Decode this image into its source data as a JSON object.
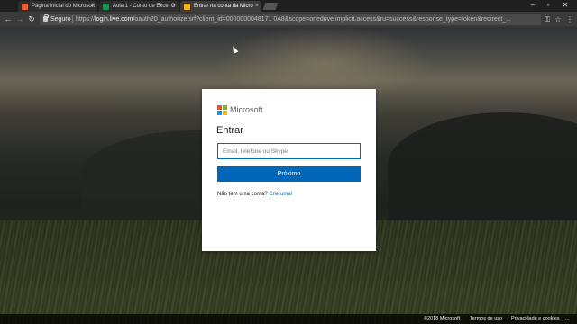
{
  "browser": {
    "tabs": [
      {
        "title": "Página Inicial do Microsoft",
        "favicon_color": "#e8633b",
        "icon": "office-icon"
      },
      {
        "title": "Aula 1 - Curso de Excel O",
        "favicon_color": "#1d8f4e",
        "icon": "excel-icon"
      },
      {
        "title": "Entrar na conta da Micro",
        "favicon_color": "#f2b21c",
        "icon": "microsoft-icon",
        "active": true
      }
    ],
    "tab_close_glyph": "×",
    "window_controls": {
      "minimize": "–",
      "restore": "▫",
      "close": "✕"
    },
    "nav": {
      "back": "←",
      "forward": "→",
      "reload": "↻"
    },
    "address_bar": {
      "security_label": "Seguro",
      "url_scheme": "https://",
      "url_host": "login.live.com",
      "url_rest": "/oauth20_authorize.srf?client_id=0000000048171 0A8&scope=onedrive.implicit.access&ru=success&response_type=token&redirect_..."
    },
    "toolbar_icons": {
      "key": "⚿",
      "star": "☆",
      "menu": "⋮"
    }
  },
  "signin": {
    "brand_name": "Microsoft",
    "logo_colors": [
      "#f25022",
      "#7fba00",
      "#00a4ef",
      "#ffb900"
    ],
    "title": "Entrar",
    "email_placeholder": "Email, telefone ou Skype",
    "email_value": "",
    "next_label": "Próximo",
    "no_account_text": "Não tem uma conta?",
    "create_link": "Crie uma!"
  },
  "footer": {
    "copyright": "©2018 Microsoft",
    "terms": "Termos de uso",
    "privacy": "Privacidade e cookies",
    "more": "..."
  }
}
